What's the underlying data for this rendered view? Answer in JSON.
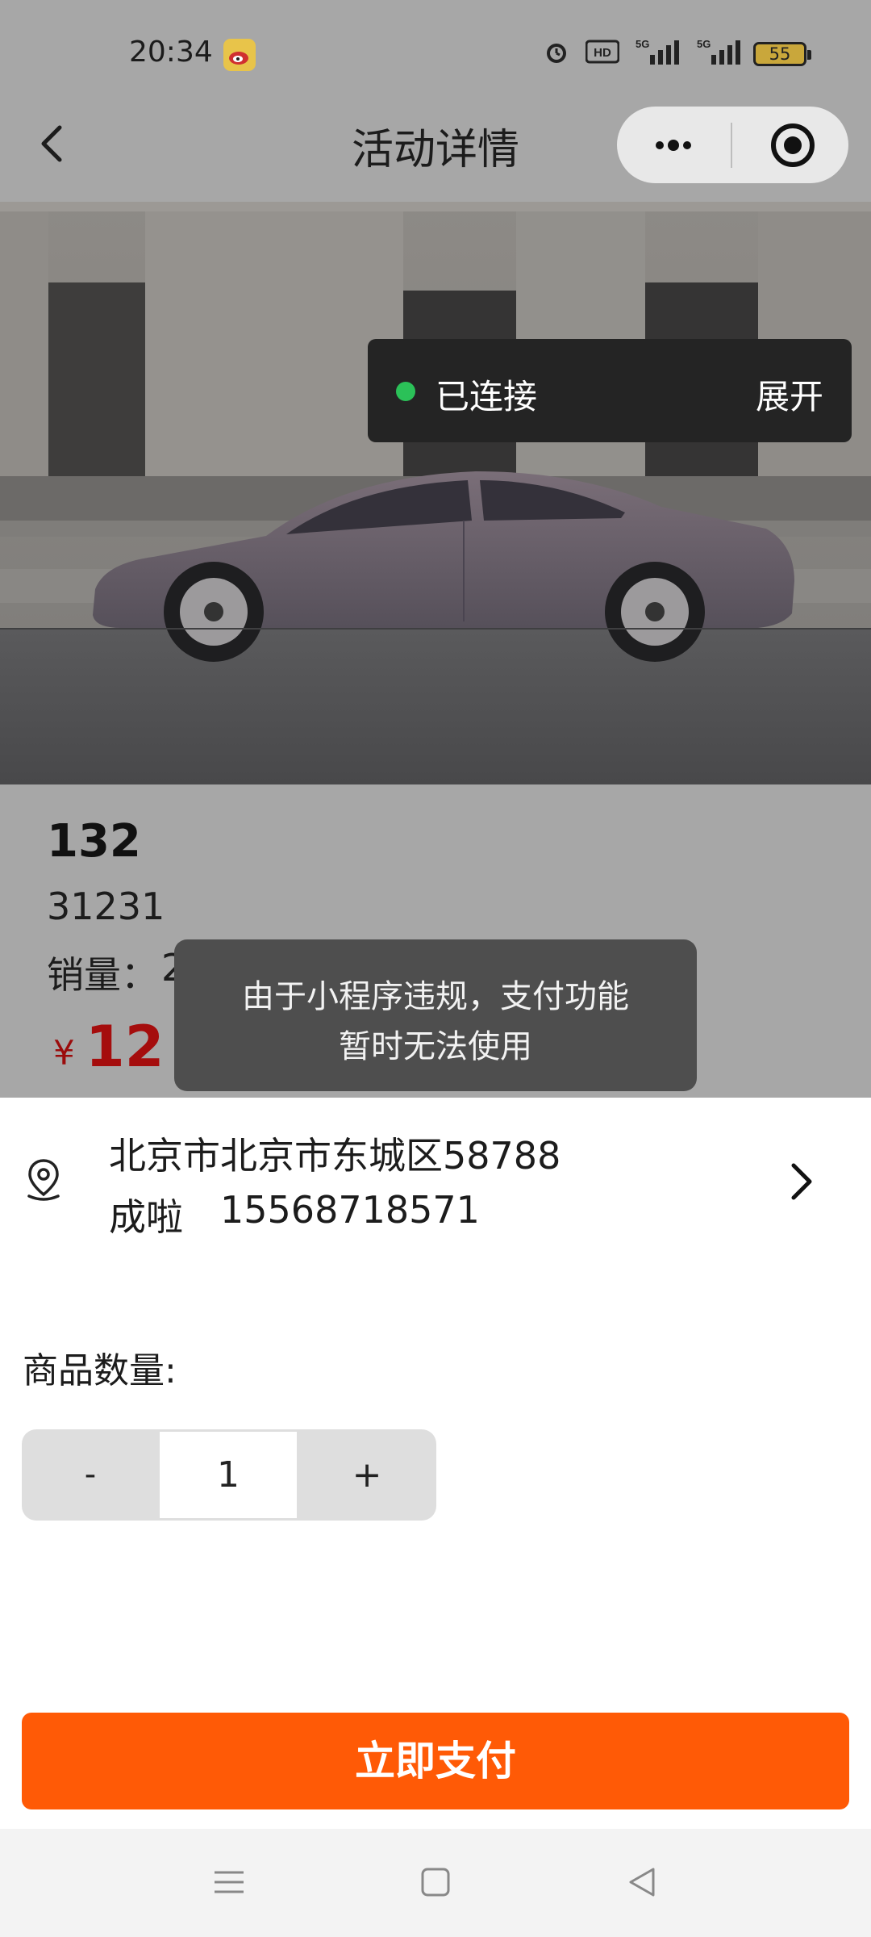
{
  "status_bar": {
    "time": "20:34",
    "battery": "55",
    "icons": [
      "weibo-icon",
      "alarm-icon",
      "hd-icon",
      "5g-signal-icon",
      "5g-signal-icon",
      "battery-icon"
    ]
  },
  "nav": {
    "title": "活动详情",
    "back_icon": "chevron-left-icon",
    "more_icon": "more-dots-icon",
    "close_icon": "target-icon"
  },
  "connection": {
    "status": "已连接",
    "expand": "展开",
    "dot_color": "#2bc158"
  },
  "product": {
    "name": "132",
    "description": "31231",
    "sales_label": "销量：",
    "sales_value": "2",
    "price_symbol": "¥",
    "price": "12"
  },
  "toast": {
    "line1": "由于小程序违规，支付功能",
    "line2": "暂时无法使用"
  },
  "address": {
    "line": "北京市北京市东城区58788",
    "name": "成啦",
    "phone": "15568718571"
  },
  "quantity": {
    "label": "商品数量:",
    "minus": "-",
    "value": "1",
    "plus": "+"
  },
  "pay_button": {
    "label": "立即支付",
    "color": "#ff5a06"
  },
  "system_nav": {
    "icons": [
      "menu-icon",
      "home-square-icon",
      "back-triangle-icon"
    ]
  }
}
